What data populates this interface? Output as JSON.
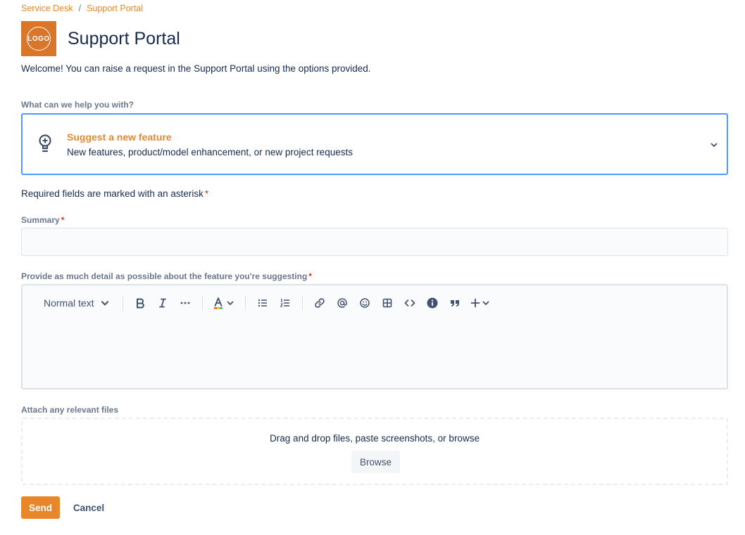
{
  "breadcrumb": {
    "items": [
      "Service Desk",
      "Support Portal"
    ],
    "separator": "/"
  },
  "portal": {
    "logo_text": "LOGO",
    "title": "Support Portal",
    "welcome": "Welcome! You can raise a request in the Support Portal using the options provided."
  },
  "request_type": {
    "label": "What can we help you with?",
    "selected_title": "Suggest a new feature",
    "selected_description": "New features, product/model enhancement, or new project requests",
    "icon": "lightbulb-icon"
  },
  "form": {
    "required_note": "Required fields are marked with an asterisk",
    "asterisk": "*",
    "summary_label": "Summary",
    "summary_value": "",
    "detail_label": "Provide as much detail as possible about the feature you're suggesting",
    "attach_label": "Attach any relevant files",
    "dropzone_text": "Drag and drop files, paste screenshots, or browse",
    "browse_label": "Browse",
    "send_label": "Send",
    "cancel_label": "Cancel"
  },
  "toolbar": {
    "text_style": "Normal text",
    "buttons": [
      "bold-icon",
      "italic-icon",
      "more-formatting-icon",
      "text-color-icon",
      "bullet-list-icon",
      "numbered-list-icon",
      "link-icon",
      "mention-icon",
      "emoji-icon",
      "table-icon",
      "code-icon",
      "info-icon",
      "quote-icon",
      "insert-plus-icon"
    ]
  },
  "colors": {
    "accent": "#e8872a",
    "focus_border": "#4c9aff",
    "required": "#de350b",
    "text": "#172b4d"
  }
}
